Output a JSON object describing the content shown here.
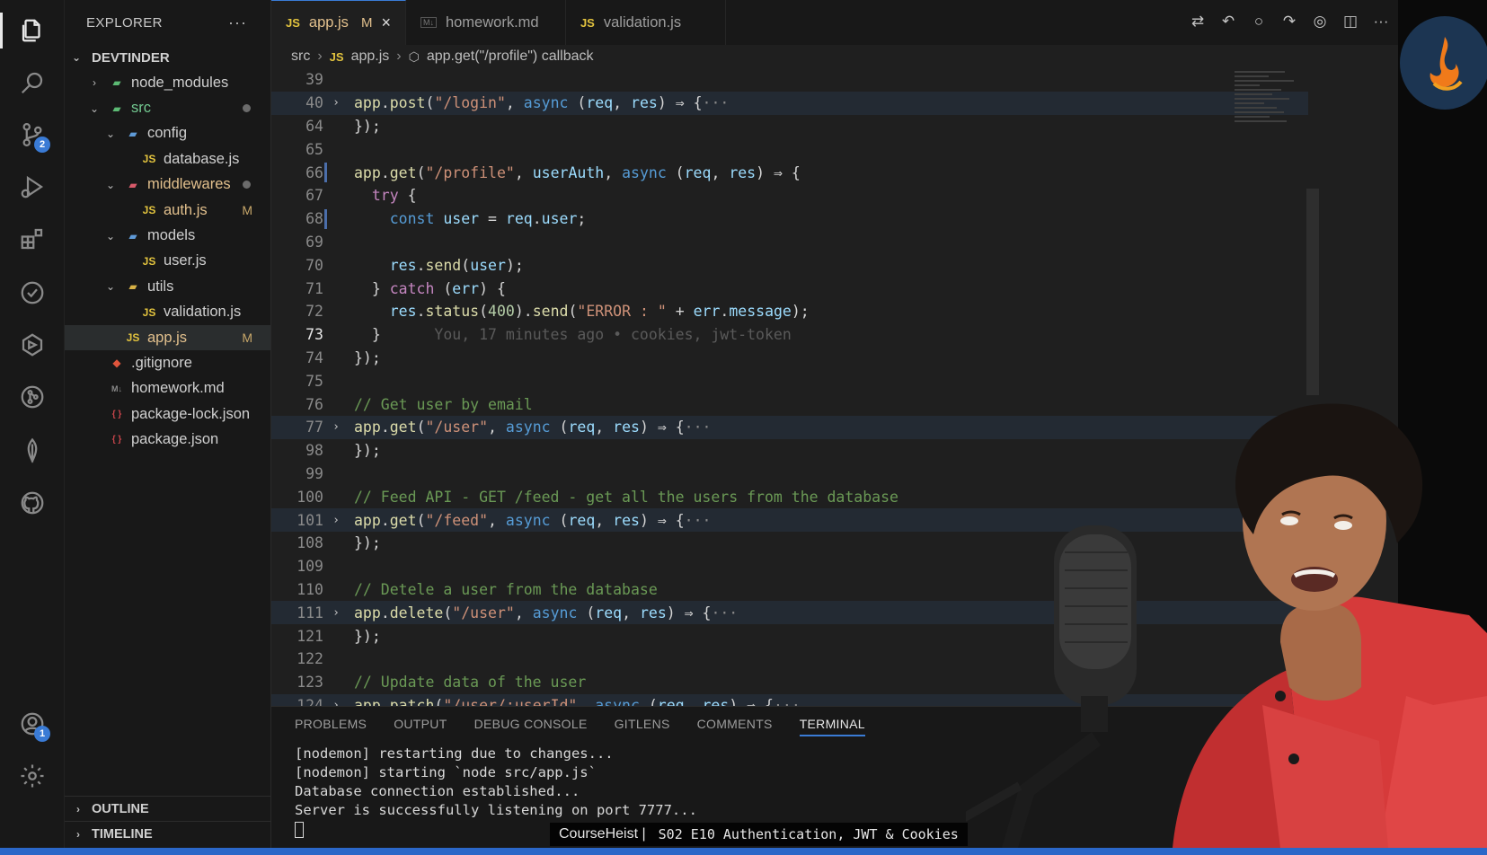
{
  "sidebar": {
    "title": "EXPLORER",
    "more": "···",
    "root": "DEVTINDER",
    "tree": [
      {
        "label": "node_modules",
        "type": "folder",
        "indent": 1,
        "open": false,
        "icon": "folder-green"
      },
      {
        "label": "src",
        "type": "folder",
        "indent": 1,
        "open": true,
        "icon": "folder-green",
        "dot": true,
        "color": "src"
      },
      {
        "label": "config",
        "type": "folder",
        "indent": 2,
        "open": true,
        "icon": "folder-blue"
      },
      {
        "label": "database.js",
        "type": "js",
        "indent": 3
      },
      {
        "label": "middlewares",
        "type": "folder",
        "indent": 2,
        "open": true,
        "icon": "folder-red",
        "dot": true,
        "color": "modified"
      },
      {
        "label": "auth.js",
        "type": "js",
        "indent": 3,
        "status": "M",
        "color": "modified"
      },
      {
        "label": "models",
        "type": "folder",
        "indent": 2,
        "open": true,
        "icon": "folder-blue"
      },
      {
        "label": "user.js",
        "type": "js",
        "indent": 3
      },
      {
        "label": "utils",
        "type": "folder",
        "indent": 2,
        "open": true,
        "icon": "folder-yellow"
      },
      {
        "label": "validation.js",
        "type": "js",
        "indent": 3
      },
      {
        "label": "app.js",
        "type": "js",
        "indent": 2,
        "status": "M",
        "color": "modified",
        "selected": true
      },
      {
        "label": ".gitignore",
        "type": "git",
        "indent": 1
      },
      {
        "label": "homework.md",
        "type": "md",
        "indent": 1
      },
      {
        "label": "package-lock.json",
        "type": "json",
        "indent": 1
      },
      {
        "label": "package.json",
        "type": "json",
        "indent": 1
      }
    ],
    "outline": "OUTLINE",
    "timeline": "TIMELINE"
  },
  "activity": {
    "scm_badge": "2",
    "accounts_badge": "1"
  },
  "tabs": [
    {
      "label": "app.js",
      "kind": "js",
      "active": true,
      "modified": "M"
    },
    {
      "label": "homework.md",
      "kind": "md"
    },
    {
      "label": "validation.js",
      "kind": "js"
    }
  ],
  "breadcrumb": {
    "folder": "src",
    "file": "app.js",
    "symbol": "app.get(\"/profile\") callback"
  },
  "code_lines": [
    {
      "n": "39",
      "t": ""
    },
    {
      "n": "40",
      "fold": true,
      "hl": true,
      "t": [
        [
          "f",
          "app"
        ],
        [
          "p",
          "."
        ],
        [
          "f",
          "post"
        ],
        [
          "p",
          "("
        ],
        [
          "s",
          "\"/login\""
        ],
        [
          "p",
          ", "
        ],
        [
          "k",
          "async"
        ],
        [
          "p",
          " ("
        ],
        [
          "v",
          "req"
        ],
        [
          "p",
          ", "
        ],
        [
          "v",
          "res"
        ],
        [
          "p",
          ") ⇒ {"
        ],
        [
          "ellipsis",
          "···"
        ]
      ]
    },
    {
      "n": "64",
      "t": [
        [
          "p",
          "});"
        ]
      ]
    },
    {
      "n": "65",
      "t": ""
    },
    {
      "n": "66",
      "mod": true,
      "t": [
        [
          "f",
          "app"
        ],
        [
          "p",
          "."
        ],
        [
          "f",
          "get"
        ],
        [
          "p",
          "("
        ],
        [
          "s",
          "\"/profile\""
        ],
        [
          "p",
          ", "
        ],
        [
          "v",
          "userAuth"
        ],
        [
          "p",
          ", "
        ],
        [
          "k",
          "async"
        ],
        [
          "p",
          " ("
        ],
        [
          "v",
          "req"
        ],
        [
          "p",
          ", "
        ],
        [
          "v",
          "res"
        ],
        [
          "p",
          ") ⇒ {"
        ]
      ]
    },
    {
      "n": "67",
      "t": [
        [
          "p",
          "  "
        ],
        [
          "fl",
          "try"
        ],
        [
          "p",
          " {"
        ]
      ]
    },
    {
      "n": "68",
      "mod": true,
      "t": [
        [
          "p",
          "    "
        ],
        [
          "k",
          "const"
        ],
        [
          "p",
          " "
        ],
        [
          "v",
          "user"
        ],
        [
          "p",
          " = "
        ],
        [
          "v",
          "req"
        ],
        [
          "p",
          "."
        ],
        [
          "v",
          "user"
        ],
        [
          "p",
          ";"
        ]
      ]
    },
    {
      "n": "69",
      "t": ""
    },
    {
      "n": "70",
      "t": [
        [
          "p",
          "    "
        ],
        [
          "v",
          "res"
        ],
        [
          "p",
          "."
        ],
        [
          "f",
          "send"
        ],
        [
          "p",
          "("
        ],
        [
          "v",
          "user"
        ],
        [
          "p",
          ");"
        ]
      ]
    },
    {
      "n": "71",
      "t": [
        [
          "p",
          "  } "
        ],
        [
          "fl",
          "catch"
        ],
        [
          "p",
          " ("
        ],
        [
          "v",
          "err"
        ],
        [
          "p",
          ") {"
        ]
      ]
    },
    {
      "n": "72",
      "t": [
        [
          "p",
          "    "
        ],
        [
          "v",
          "res"
        ],
        [
          "p",
          "."
        ],
        [
          "f",
          "status"
        ],
        [
          "p",
          "("
        ],
        [
          "n",
          "400"
        ],
        [
          "p",
          ")."
        ],
        [
          "f",
          "send"
        ],
        [
          "p",
          "("
        ],
        [
          "s",
          "\"ERROR : \""
        ],
        [
          "p",
          " + "
        ],
        [
          "v",
          "err"
        ],
        [
          "p",
          "."
        ],
        [
          "v",
          "message"
        ],
        [
          "p",
          ");"
        ]
      ]
    },
    {
      "n": "73",
      "cur": true,
      "t": [
        [
          "p",
          "  }"
        ],
        [
          "blame",
          "      You, 17 minutes ago • cookies, jwt-token"
        ]
      ]
    },
    {
      "n": "74",
      "t": [
        [
          "p",
          "});"
        ]
      ]
    },
    {
      "n": "75",
      "t": ""
    },
    {
      "n": "76",
      "t": [
        [
          "c",
          "// Get user by email"
        ]
      ]
    },
    {
      "n": "77",
      "fold": true,
      "hl": true,
      "t": [
        [
          "f",
          "app"
        ],
        [
          "p",
          "."
        ],
        [
          "f",
          "get"
        ],
        [
          "p",
          "("
        ],
        [
          "s",
          "\"/user\""
        ],
        [
          "p",
          ", "
        ],
        [
          "k",
          "async"
        ],
        [
          "p",
          " ("
        ],
        [
          "v",
          "req"
        ],
        [
          "p",
          ", "
        ],
        [
          "v",
          "res"
        ],
        [
          "p",
          ") ⇒ {"
        ],
        [
          "ellipsis",
          "···"
        ]
      ]
    },
    {
      "n": "98",
      "t": [
        [
          "p",
          "});"
        ]
      ]
    },
    {
      "n": "99",
      "t": ""
    },
    {
      "n": "100",
      "t": [
        [
          "c",
          "// Feed API - GET /feed - get all the users from the database"
        ]
      ]
    },
    {
      "n": "101",
      "fold": true,
      "hl": true,
      "t": [
        [
          "f",
          "app"
        ],
        [
          "p",
          "."
        ],
        [
          "f",
          "get"
        ],
        [
          "p",
          "("
        ],
        [
          "s",
          "\"/feed\""
        ],
        [
          "p",
          ", "
        ],
        [
          "k",
          "async"
        ],
        [
          "p",
          " ("
        ],
        [
          "v",
          "req"
        ],
        [
          "p",
          ", "
        ],
        [
          "v",
          "res"
        ],
        [
          "p",
          ") ⇒ {"
        ],
        [
          "ellipsis",
          "···"
        ]
      ]
    },
    {
      "n": "108",
      "t": [
        [
          "p",
          "});"
        ]
      ]
    },
    {
      "n": "109",
      "t": ""
    },
    {
      "n": "110",
      "t": [
        [
          "c",
          "// Detele a user from the database"
        ]
      ]
    },
    {
      "n": "111",
      "fold": true,
      "hl": true,
      "t": [
        [
          "f",
          "app"
        ],
        [
          "p",
          "."
        ],
        [
          "f",
          "delete"
        ],
        [
          "p",
          "("
        ],
        [
          "s",
          "\"/user\""
        ],
        [
          "p",
          ", "
        ],
        [
          "k",
          "async"
        ],
        [
          "p",
          " ("
        ],
        [
          "v",
          "req"
        ],
        [
          "p",
          ", "
        ],
        [
          "v",
          "res"
        ],
        [
          "p",
          ") ⇒ {"
        ],
        [
          "ellipsis",
          "···"
        ]
      ]
    },
    {
      "n": "121",
      "t": [
        [
          "p",
          "});"
        ]
      ]
    },
    {
      "n": "122",
      "t": ""
    },
    {
      "n": "123",
      "t": [
        [
          "c",
          "// Update data of the user"
        ]
      ]
    },
    {
      "n": "124",
      "fold": true,
      "hl": true,
      "t": [
        [
          "f",
          "app"
        ],
        [
          "p",
          "."
        ],
        [
          "f",
          "patch"
        ],
        [
          "p",
          "("
        ],
        [
          "s",
          "\"/user/:userId\""
        ],
        [
          "p",
          ", "
        ],
        [
          "k",
          "async"
        ],
        [
          "p",
          " ("
        ],
        [
          "v",
          "req"
        ],
        [
          "p",
          ", "
        ],
        [
          "v",
          "res"
        ],
        [
          "p",
          ") ⇒ {"
        ],
        [
          "ellipsis",
          "···"
        ]
      ]
    }
  ],
  "panel": {
    "tabs": [
      "PROBLEMS",
      "OUTPUT",
      "DEBUG CONSOLE",
      "GITLENS",
      "COMMENTS",
      "TERMINAL"
    ],
    "active_tab": "TERMINAL",
    "terminal_lines": [
      "[nodemon] restarting due to changes...",
      "[nodemon] starting `node src/app.js`",
      "Database connection established...",
      "Server is successfully listening on port 7777..."
    ]
  },
  "watermark": {
    "brand": "CourseHeist |",
    "title": "S02 E10 Authentication, JWT & Cookies"
  },
  "colors": {
    "accent": "#3a7bd5",
    "status_bar": "#2b67c8",
    "editor_bg": "#1f1f1f",
    "sidebar_bg": "#181818"
  }
}
